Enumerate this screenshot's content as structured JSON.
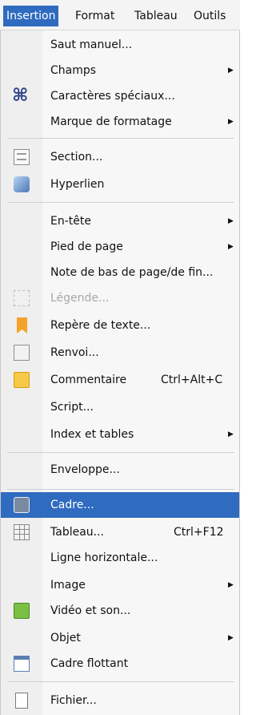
{
  "menubar": {
    "items": [
      {
        "label": "Insertion"
      },
      {
        "label": "Format"
      },
      {
        "label": "Tableau"
      },
      {
        "label": "Outils"
      }
    ]
  },
  "menu": {
    "items": [
      {
        "label": "Saut manuel..."
      },
      {
        "label": "Champs"
      },
      {
        "label": "Caractères spéciaux..."
      },
      {
        "label": "Marque de formatage"
      },
      {
        "label": "Section..."
      },
      {
        "label": "Hyperlien"
      },
      {
        "label": "En-tête"
      },
      {
        "label": "Pied de page"
      },
      {
        "label": "Note de bas de page/de fin..."
      },
      {
        "label": "Légende..."
      },
      {
        "label": "Repère de texte..."
      },
      {
        "label": "Renvoi..."
      },
      {
        "label": "Commentaire",
        "shortcut": "Ctrl+Alt+C"
      },
      {
        "label": "Script..."
      },
      {
        "label": "Index et tables"
      },
      {
        "label": "Enveloppe..."
      },
      {
        "label": "Cadre..."
      },
      {
        "label": "Tableau...",
        "shortcut": "Ctrl+F12"
      },
      {
        "label": "Ligne horizontale..."
      },
      {
        "label": "Image"
      },
      {
        "label": "Vidéo et son..."
      },
      {
        "label": "Objet"
      },
      {
        "label": "Cadre flottant"
      },
      {
        "label": "Fichier..."
      }
    ]
  },
  "icons": {
    "caracteres_speciaux": "command-icon",
    "section": "section-icon",
    "hyperlien": "hyperlink-icon",
    "legende": "caption-icon",
    "repere": "bookmark-icon",
    "renvoi": "cross-reference-icon",
    "commentaire": "comment-icon",
    "cadre": "frame-icon",
    "tableau": "table-icon",
    "video": "video-icon",
    "cadre_flottant": "floating-frame-icon",
    "fichier": "file-icon"
  },
  "colors": {
    "accent": "#2f6bbf",
    "disabled_text": "#a8a8a8"
  }
}
